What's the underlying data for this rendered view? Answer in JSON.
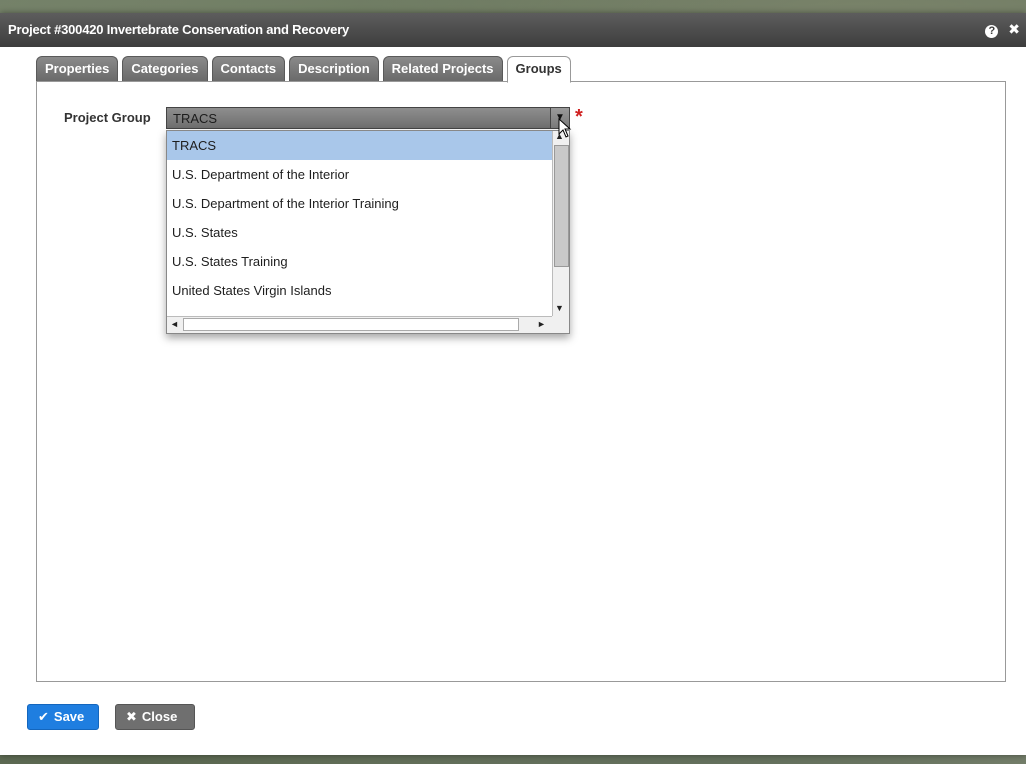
{
  "dialog": {
    "title": "Project #300420 Invertebrate Conservation and Recovery",
    "help_icon": "?",
    "close_icon": "✖"
  },
  "tabs": [
    {
      "label": "Properties",
      "active": false
    },
    {
      "label": "Categories",
      "active": false
    },
    {
      "label": "Contacts",
      "active": false
    },
    {
      "label": "Description",
      "active": false
    },
    {
      "label": "Related Projects",
      "active": false
    },
    {
      "label": "Groups",
      "active": true
    }
  ],
  "form": {
    "project_group_label": "Project Group",
    "project_group_value": "TRACS",
    "required_marker": "*"
  },
  "dropdown": {
    "options": [
      {
        "label": "TRACS",
        "selected": true
      },
      {
        "label": "U.S. Department of the Interior",
        "selected": false
      },
      {
        "label": "U.S. Department of the Interior Training",
        "selected": false
      },
      {
        "label": "U.S. States",
        "selected": false
      },
      {
        "label": "U.S. States Training",
        "selected": false
      },
      {
        "label": "United States Virgin Islands",
        "selected": false
      }
    ]
  },
  "footer": {
    "save_label": "Save",
    "close_label": "Close"
  },
  "colors": {
    "primary": "#1f7ee0",
    "selection": "#a9c7ea",
    "required": "#d02020"
  }
}
